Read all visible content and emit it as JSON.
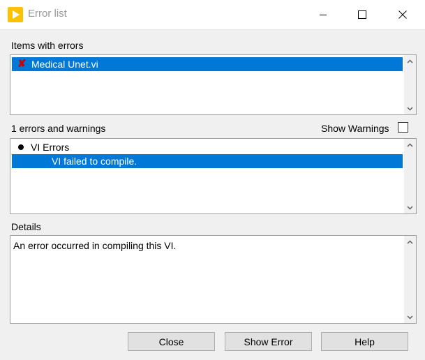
{
  "window": {
    "title": "Error list",
    "accent_color": "#fcc200"
  },
  "items_section": {
    "label": "Items with errors",
    "items": [
      {
        "icon": "red-x-error-icon",
        "name": "Medical Unet.vi",
        "selected": true
      }
    ]
  },
  "errors_section": {
    "label": "1 errors and warnings",
    "show_warnings_label": "Show Warnings",
    "show_warnings_checked": false,
    "group": {
      "icon": "bullet-icon",
      "label": "VI Errors"
    },
    "errors": [
      {
        "message": "VI failed to compile.",
        "selected": true
      }
    ]
  },
  "details_section": {
    "label": "Details",
    "text": "An error occurred in compiling this VI."
  },
  "buttons": {
    "close": "Close",
    "show_error": "Show Error",
    "help": "Help"
  },
  "colors": {
    "selection": "#0078d7",
    "error_icon": "#cc0000"
  }
}
